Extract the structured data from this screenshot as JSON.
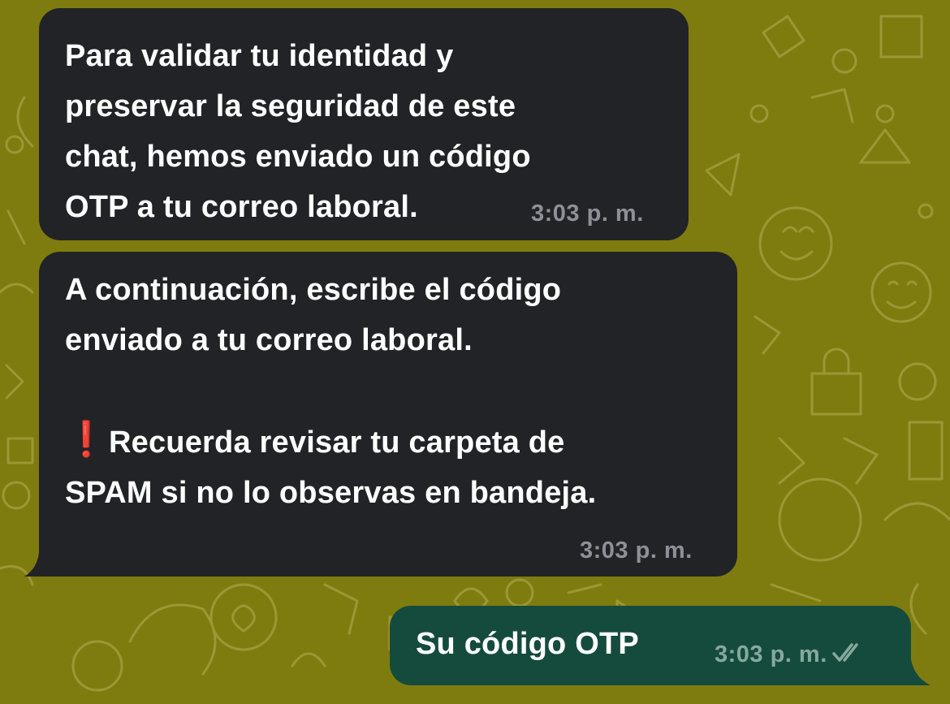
{
  "chat": {
    "messages": [
      {
        "direction": "incoming",
        "text": "Para validar tu identidad y\npreservar la seguridad de este\nchat, hemos enviado un código\nOTP a tu correo laboral.",
        "time": "3:03 p. m."
      },
      {
        "direction": "incoming",
        "text_line1": "A continuación, escribe el código\nenviado a tu correo laboral.",
        "alert_icon": "exclamation-mark",
        "alert_text": "Recuerda revisar tu carpeta de\nSPAM si no lo observas en bandeja.",
        "time": "3:03 p. m."
      },
      {
        "direction": "outgoing",
        "text": "Su código OTP",
        "time": "3:03 p. m.",
        "status_icon": "double-check-icon"
      }
    ]
  },
  "colors": {
    "wallpaper": "#7f7c0f",
    "incoming_bubble": "#222326",
    "outgoing_bubble": "#154b3d",
    "alert": "#e0161b"
  }
}
